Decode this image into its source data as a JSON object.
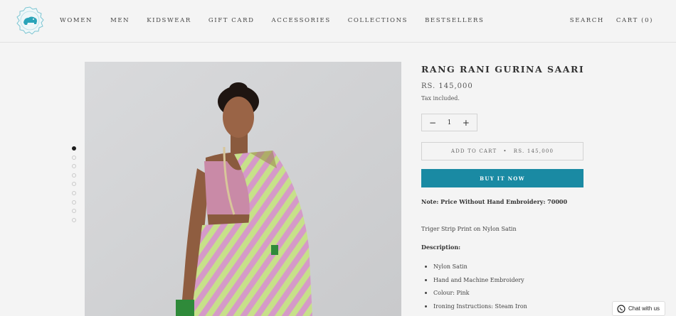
{
  "nav": {
    "items": [
      "WOMEN",
      "MEN",
      "KIDSWEAR",
      "GIFT CARD",
      "ACCESSORIES",
      "COLLECTIONS",
      "BESTSELLERS"
    ],
    "search_label": "SEARCH",
    "cart_label": "CART (0)"
  },
  "gallery": {
    "dot_count": 9,
    "active_index": 0
  },
  "product": {
    "title": "RANG RANI GURINA SAARI",
    "price": "RS. 145,000",
    "tax_note": "Tax included.",
    "quantity": "1",
    "minus_symbol": "−",
    "plus_symbol": "+",
    "add_to_cart_label": "ADD TO CART",
    "add_to_cart_separator": "•",
    "add_to_cart_price": "RS. 145,000",
    "buy_now_label": "BUY IT NOW",
    "note": "Note: Price Without Hand Embroidery: 70000",
    "short_description": "Triger Strip Print on Nylon Satin",
    "description_heading": "Description:",
    "bullets": [
      "Nylon Satin",
      "Hand and Machine Embroidery",
      "Colour: Pink",
      "Ironing Instructions: Steam Iron"
    ]
  },
  "chat": {
    "label": "Chat with us"
  },
  "colors": {
    "accent": "#1a8aa3",
    "logo": "#2aa4b9",
    "background": "#f4f4f4"
  }
}
